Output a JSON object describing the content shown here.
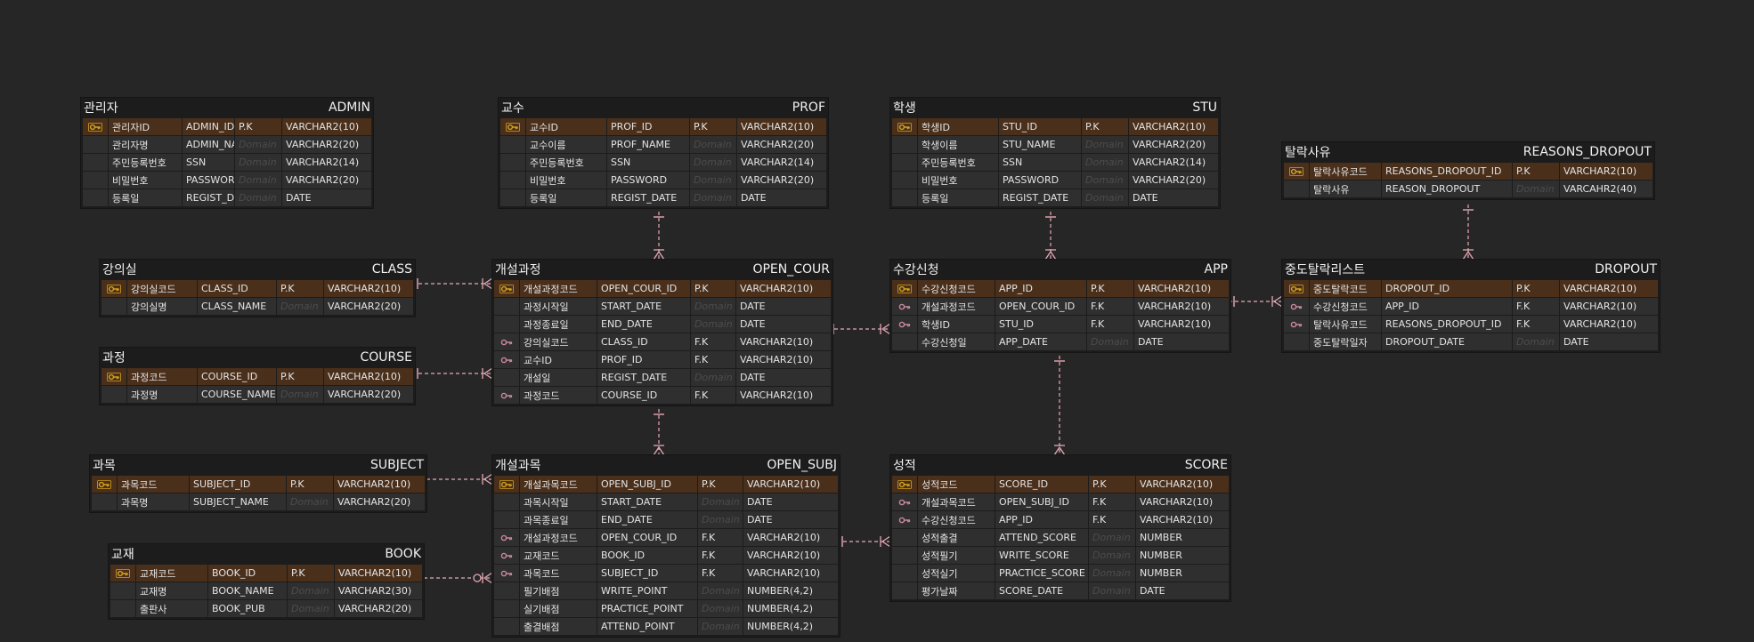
{
  "colors": {
    "background": "#262626",
    "pk_row": "#4a2f1b",
    "pk_icon": "#d4a41c",
    "fk_icon": "#c8889a",
    "relation": "#e6a9b6"
  },
  "entities": [
    {
      "id": "ADMIN",
      "kor": "관리자",
      "eng": "ADMIN",
      "rows": [
        {
          "key": "pk",
          "kor": "관리자ID",
          "eng": "ADMIN_ID",
          "cons": "P.K",
          "type": "VARCHAR2(10)"
        },
        {
          "key": "",
          "kor": "관리자명",
          "eng": "ADMIN_NAME",
          "cons": "Domain",
          "type": "VARCHAR2(20)"
        },
        {
          "key": "",
          "kor": "주민등록번호",
          "eng": "SSN",
          "cons": "Domain",
          "type": "VARCHAR2(14)"
        },
        {
          "key": "",
          "kor": "비밀번호",
          "eng": "PASSWORD",
          "cons": "Domain",
          "type": "VARCHAR2(20)"
        },
        {
          "key": "",
          "kor": "등록일",
          "eng": "REGIST_DATE",
          "cons": "Domain",
          "type": "DATE"
        }
      ]
    },
    {
      "id": "PROF",
      "kor": "교수",
      "eng": "PROF",
      "rows": [
        {
          "key": "pk",
          "kor": "교수ID",
          "eng": "PROF_ID",
          "cons": "P.K",
          "type": "VARCHAR2(10)"
        },
        {
          "key": "",
          "kor": "교수이름",
          "eng": "PROF_NAME",
          "cons": "Domain",
          "type": "VARCHAR2(20)"
        },
        {
          "key": "",
          "kor": "주민등록번호",
          "eng": "SSN",
          "cons": "Domain",
          "type": "VARCHAR2(14)"
        },
        {
          "key": "",
          "kor": "비밀번호",
          "eng": "PASSWORD",
          "cons": "Domain",
          "type": "VARCHAR2(20)"
        },
        {
          "key": "",
          "kor": "등록일",
          "eng": "REGIST_DATE",
          "cons": "Domain",
          "type": "DATE"
        }
      ]
    },
    {
      "id": "STU",
      "kor": "학생",
      "eng": "STU",
      "rows": [
        {
          "key": "pk",
          "kor": "학생ID",
          "eng": "STU_ID",
          "cons": "P.K",
          "type": "VARCHAR2(10)"
        },
        {
          "key": "",
          "kor": "학생이름",
          "eng": "STU_NAME",
          "cons": "Domain",
          "type": "VARCHAR2(20)"
        },
        {
          "key": "",
          "kor": "주민등록번호",
          "eng": "SSN",
          "cons": "Domain",
          "type": "VARCHAR2(14)"
        },
        {
          "key": "",
          "kor": "비밀번호",
          "eng": "PASSWORD",
          "cons": "Domain",
          "type": "VARCHAR2(20)"
        },
        {
          "key": "",
          "kor": "등록일",
          "eng": "REGIST_DATE",
          "cons": "Domain",
          "type": "DATE"
        }
      ]
    },
    {
      "id": "REASONS_DROPOUT",
      "kor": "탈락사유",
      "eng": "REASONS_DROPOUT",
      "rows": [
        {
          "key": "pk",
          "kor": "탈락사유코드",
          "eng": "REASONS_DROPOUT_ID",
          "cons": "P.K",
          "type": "VARCHAR2(10)"
        },
        {
          "key": "",
          "kor": "탈락사유",
          "eng": "REASON_DROPOUT",
          "cons": "Domain",
          "type": "VARCAHR2(40)"
        }
      ]
    },
    {
      "id": "CLASS",
      "kor": "강의실",
      "eng": "CLASS",
      "rows": [
        {
          "key": "pk",
          "kor": "강의실코드",
          "eng": "CLASS_ID",
          "cons": "P.K",
          "type": "VARCHAR2(10)"
        },
        {
          "key": "",
          "kor": "강의실명",
          "eng": "CLASS_NAME",
          "cons": "Domain",
          "type": "VARCHAR2(20)"
        }
      ]
    },
    {
      "id": "COURSE",
      "kor": "과정",
      "eng": "COURSE",
      "rows": [
        {
          "key": "pk",
          "kor": "과정코드",
          "eng": "COURSE_ID",
          "cons": "P.K",
          "type": "VARCHAR2(10)"
        },
        {
          "key": "",
          "kor": "과정명",
          "eng": "COURSE_NAME",
          "cons": "Domain",
          "type": "VARCHAR2(20)"
        }
      ]
    },
    {
      "id": "OPEN_COUR",
      "kor": "개설과정",
      "eng": "OPEN_COUR",
      "rows": [
        {
          "key": "pk",
          "kor": "개설과정코드",
          "eng": "OPEN_COUR_ID",
          "cons": "P.K",
          "type": "VARCHAR2(10)"
        },
        {
          "key": "",
          "kor": "과정시작일",
          "eng": "START_DATE",
          "cons": "Domain",
          "type": "DATE"
        },
        {
          "key": "",
          "kor": "과정종료일",
          "eng": "END_DATE",
          "cons": "Domain",
          "type": "DATE"
        },
        {
          "key": "fk",
          "kor": "강의실코드",
          "eng": "CLASS_ID",
          "cons": "F.K",
          "type": "VARCHAR2(10)"
        },
        {
          "key": "fk",
          "kor": "교수ID",
          "eng": "PROF_ID",
          "cons": "F.K",
          "type": "VARCHAR2(10)"
        },
        {
          "key": "",
          "kor": "개설일",
          "eng": "REGIST_DATE",
          "cons": "Domain",
          "type": "DATE"
        },
        {
          "key": "fk",
          "kor": "과정코드",
          "eng": "COURSE_ID",
          "cons": "F.K",
          "type": "VARCHAR2(10)"
        }
      ]
    },
    {
      "id": "APP",
      "kor": "수강신청",
      "eng": "APP",
      "rows": [
        {
          "key": "pk",
          "kor": "수강신청코드",
          "eng": "APP_ID",
          "cons": "P.K",
          "type": "VARCHAR2(10)"
        },
        {
          "key": "fk",
          "kor": "개설과정코드",
          "eng": "OPEN_COUR_ID",
          "cons": "F.K",
          "type": "VARCHAR2(10)"
        },
        {
          "key": "fk",
          "kor": "학생ID",
          "eng": "STU_ID",
          "cons": "F.K",
          "type": "VARCHAR2(10)"
        },
        {
          "key": "",
          "kor": "수강신청일",
          "eng": "APP_DATE",
          "cons": "Domain",
          "type": "DATE"
        }
      ]
    },
    {
      "id": "DROPOUT",
      "kor": "중도탈락리스트",
      "eng": "DROPOUT",
      "rows": [
        {
          "key": "pk",
          "kor": "중도탈락코드",
          "eng": "DROPOUT_ID",
          "cons": "P.K",
          "type": "VARCHAR2(10)"
        },
        {
          "key": "fk",
          "kor": "수강신청코드",
          "eng": "APP_ID",
          "cons": "F.K",
          "type": "VARCHAR2(10)"
        },
        {
          "key": "fk",
          "kor": "탈락사유코드",
          "eng": "REASONS_DROPOUT_ID",
          "cons": "F.K",
          "type": "VARCHAR2(10)"
        },
        {
          "key": "",
          "kor": "중도탈락일자",
          "eng": "DROPOUT_DATE",
          "cons": "Domain",
          "type": "DATE"
        }
      ]
    },
    {
      "id": "SUBJECT",
      "kor": "과목",
      "eng": "SUBJECT",
      "rows": [
        {
          "key": "pk",
          "kor": "과목코드",
          "eng": "SUBJECT_ID",
          "cons": "P.K",
          "type": "VARCHAR2(10)"
        },
        {
          "key": "",
          "kor": "과목명",
          "eng": "SUBJECT_NAME",
          "cons": "Domain",
          "type": "VARCHAR2(20)"
        }
      ]
    },
    {
      "id": "BOOK",
      "kor": "교재",
      "eng": "BOOK",
      "rows": [
        {
          "key": "pk",
          "kor": "교재코드",
          "eng": "BOOK_ID",
          "cons": "P.K",
          "type": "VARCHAR2(10)"
        },
        {
          "key": "",
          "kor": "교재명",
          "eng": "BOOK_NAME",
          "cons": "Domain",
          "type": "VARCHAR2(30)"
        },
        {
          "key": "",
          "kor": "출판사",
          "eng": "BOOK_PUB",
          "cons": "Domain",
          "type": "VARCHAR2(20)"
        }
      ]
    },
    {
      "id": "OPEN_SUBJ",
      "kor": "개설과목",
      "eng": "OPEN_SUBJ",
      "rows": [
        {
          "key": "pk",
          "kor": "개설과목코드",
          "eng": "OPEN_SUBJ_ID",
          "cons": "P.K",
          "type": "VARCHAR2(10)"
        },
        {
          "key": "",
          "kor": "과목시작일",
          "eng": "START_DATE",
          "cons": "Domain",
          "type": "DATE"
        },
        {
          "key": "",
          "kor": "과목종료일",
          "eng": "END_DATE",
          "cons": "Domain",
          "type": "DATE"
        },
        {
          "key": "fk",
          "kor": "개설과정코드",
          "eng": "OPEN_COUR_ID",
          "cons": "F.K",
          "type": "VARCHAR2(10)"
        },
        {
          "key": "fk",
          "kor": "교재코드",
          "eng": "BOOK_ID",
          "cons": "F.K",
          "type": "VARCHAR2(10)"
        },
        {
          "key": "fk",
          "kor": "과목코드",
          "eng": "SUBJECT_ID",
          "cons": "F.K",
          "type": "VARCHAR2(10)"
        },
        {
          "key": "",
          "kor": "필기배점",
          "eng": "WRITE_POINT",
          "cons": "Domain",
          "type": "NUMBER(4,2)"
        },
        {
          "key": "",
          "kor": "실기배점",
          "eng": "PRACTICE_POINT",
          "cons": "Domain",
          "type": "NUMBER(4,2)"
        },
        {
          "key": "",
          "kor": "출결배점",
          "eng": "ATTEND_POINT",
          "cons": "Domain",
          "type": "NUMBER(4,2)"
        }
      ]
    },
    {
      "id": "SCORE",
      "kor": "성적",
      "eng": "SCORE",
      "rows": [
        {
          "key": "pk",
          "kor": "성적코드",
          "eng": "SCORE_ID",
          "cons": "P.K",
          "type": "VARCHAR2(10)"
        },
        {
          "key": "fk",
          "kor": "개설과목코드",
          "eng": "OPEN_SUBJ_ID",
          "cons": "F.K",
          "type": "VARCHAR2(10)"
        },
        {
          "key": "fk",
          "kor": "수강신청코드",
          "eng": "APP_ID",
          "cons": "F.K",
          "type": "VARCHAR2(10)"
        },
        {
          "key": "",
          "kor": "성적출결",
          "eng": "ATTEND_SCORE",
          "cons": "Domain",
          "type": "NUMBER"
        },
        {
          "key": "",
          "kor": "성적필기",
          "eng": "WRITE_SCORE",
          "cons": "Domain",
          "type": "NUMBER"
        },
        {
          "key": "",
          "kor": "성적실기",
          "eng": "PRACTICE_SCORE",
          "cons": "Domain",
          "type": "NUMBER"
        },
        {
          "key": "",
          "kor": "평가날짜",
          "eng": "SCORE_DATE",
          "cons": "Domain",
          "type": "DATE"
        }
      ]
    }
  ],
  "relationships": [
    {
      "from": "CLASS",
      "to": "OPEN_COUR",
      "end": "many"
    },
    {
      "from": "COURSE",
      "to": "OPEN_COUR",
      "end": "many"
    },
    {
      "from": "PROF",
      "to": "OPEN_COUR",
      "end": "many"
    },
    {
      "from": "OPEN_COUR",
      "to": "APP",
      "end": "many"
    },
    {
      "from": "STU",
      "to": "APP",
      "end": "many"
    },
    {
      "from": "REASONS_DROPOUT",
      "to": "DROPOUT",
      "end": "many"
    },
    {
      "from": "APP",
      "to": "DROPOUT",
      "end": "many"
    },
    {
      "from": "OPEN_COUR",
      "to": "OPEN_SUBJ",
      "end": "many"
    },
    {
      "from": "SUBJECT",
      "to": "OPEN_SUBJ",
      "end": "many"
    },
    {
      "from": "BOOK",
      "to": "OPEN_SUBJ",
      "end": "zero-many"
    },
    {
      "from": "OPEN_SUBJ",
      "to": "SCORE",
      "end": "many"
    },
    {
      "from": "APP",
      "to": "SCORE",
      "end": "many"
    }
  ]
}
